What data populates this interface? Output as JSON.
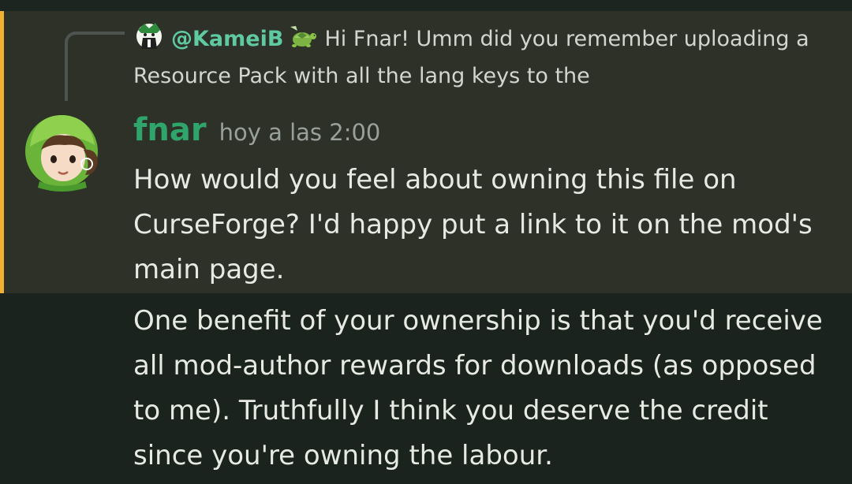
{
  "reply": {
    "author": "@KameiB",
    "text": "Hi Fnar! Umm did you remember uploading a Resource Pack with all the lang keys to the"
  },
  "message": {
    "author": "fnar",
    "timestamp": "hoy a las 2:00",
    "paragraphs": [
      "How would you feel about owning this file on CurseForge? I'd happy put a link to it on the mod's main page.",
      "One benefit of your ownership is that you'd receive all mod-author rewards for downloads (as opposed to me). Truthfully I think you deserve the credit since you're owning the labour."
    ]
  },
  "colors": {
    "mention_bar": "#f0b232",
    "highlight_bg": "#2d3127",
    "author_color": "#2fa56c",
    "reply_author_color": "#5fc9a2"
  },
  "icons": {
    "reply_avatar": "reply-user-avatar-icon",
    "badge": "turtle-emoji-icon",
    "author_avatar": "fnar-avatar-icon"
  }
}
